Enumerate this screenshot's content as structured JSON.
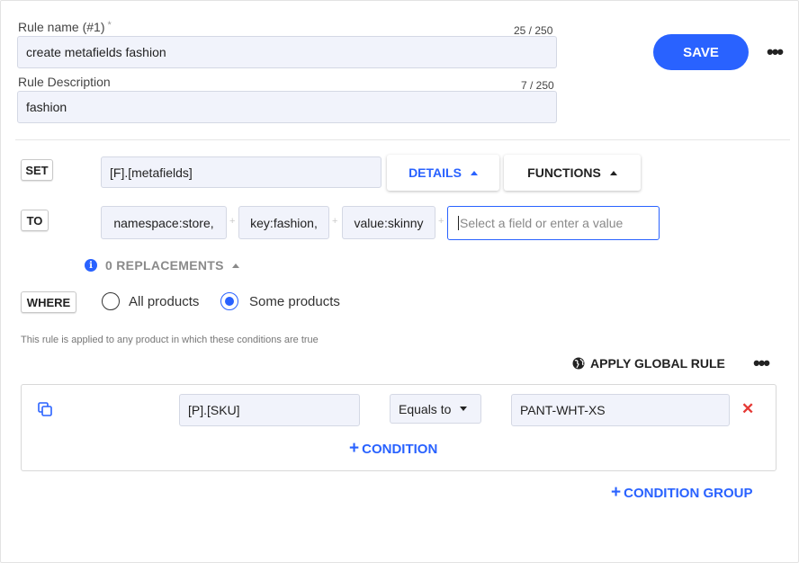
{
  "rule_name": {
    "label": "Rule name (#1)",
    "required_mark": "*",
    "counter": "25 / 250",
    "value": "create metafields fashion"
  },
  "rule_description": {
    "label": "Rule Description",
    "counter": "7 / 250",
    "value": "fashion"
  },
  "header": {
    "save_label": "SAVE",
    "more_label": "•••"
  },
  "set_row": {
    "keyword": "SET",
    "field_value": "[F].[metafields]",
    "details_label": "DETAILS",
    "functions_label": "FUNCTIONS"
  },
  "to_row": {
    "keyword": "TO",
    "chips": [
      "namespace:store,",
      "key:fashion,",
      "value:skinny"
    ],
    "separator": "+",
    "input_placeholder": "Select a field or enter a value"
  },
  "replacements": {
    "info_glyph": "i",
    "label": "0 REPLACEMENTS"
  },
  "where_row": {
    "keyword": "WHERE",
    "options": [
      {
        "label": "All products",
        "selected": false
      },
      {
        "label": "Some products",
        "selected": true
      }
    ],
    "hint": "This rule is applied to any product in which these conditions are true"
  },
  "global_rule": {
    "label": "APPLY GLOBAL RULE",
    "more_label": "•••"
  },
  "condition_group": {
    "field": "[P].[SKU]",
    "operator": "Equals to",
    "value": "PANT-WHT-XS",
    "remove_label": "✕",
    "add_condition_label": "CONDITION",
    "plus": "+"
  },
  "add_group": {
    "plus": "+",
    "label": "CONDITION GROUP"
  },
  "colors": {
    "accent": "#2962ff",
    "danger": "#e53935",
    "field_bg": "#f1f3fb"
  }
}
